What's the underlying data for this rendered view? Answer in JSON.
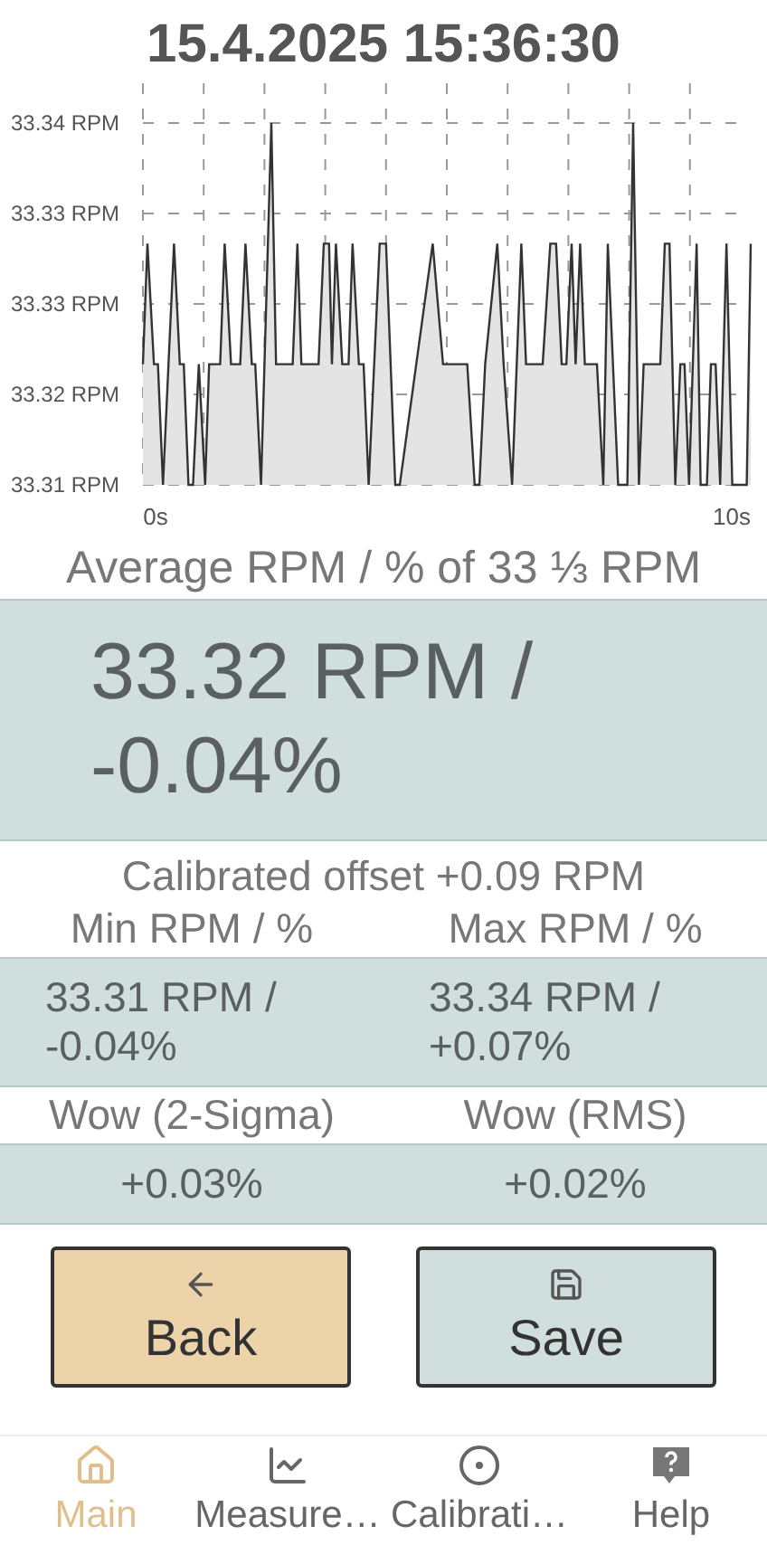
{
  "title": "15.4.2025 15:36:30",
  "chart": {
    "chart_data": {
      "type": "area",
      "grid": true,
      "xlim": [
        -0.22,
        10.33
      ],
      "ylim": [
        33.31,
        33.34
      ],
      "xticks": [
        {
          "value": 0,
          "label": "0s"
        },
        {
          "value": 10,
          "label": "10s"
        }
      ],
      "yticks": [
        {
          "value": 33.31,
          "label": "33.31 RPM"
        },
        {
          "value": 33.3175,
          "label": "33.32 RPM"
        },
        {
          "value": 33.325,
          "label": "33.33 RPM"
        },
        {
          "value": 33.3325,
          "label": "33.33 RPM"
        },
        {
          "value": 33.34,
          "label": "33.34 RPM"
        }
      ],
      "x": [
        -0.22,
        -0.14,
        -0.03,
        0.04,
        0.13,
        0.32,
        0.42,
        0.49,
        0.57,
        0.65,
        0.75,
        0.86,
        0.93,
        1.12,
        1.2,
        1.31,
        1.47,
        1.56,
        1.67,
        1.73,
        1.83,
        2.01,
        2.09,
        2.38,
        2.46,
        2.53,
        2.83,
        2.92,
        3.01,
        3.06,
        3.13,
        3.24,
        3.35,
        3.42,
        3.53,
        3.61,
        3.7,
        3.89,
        4,
        4.16,
        4.24,
        4.81,
        4.99,
        5.41,
        5.54,
        5.62,
        5.72,
        5.93,
        6.04,
        6.19,
        6.35,
        6.43,
        6.72,
        6.85,
        6.95,
        7.05,
        7.13,
        7.22,
        7.29,
        7.37,
        7.45,
        7.66,
        7.77,
        7.85,
        8.03,
        8.19,
        8.29,
        8.39,
        8.47,
        8.76,
        8.84,
        8.92,
        9.02,
        9.11,
        9.18,
        9.26,
        9.39,
        9.46,
        9.57,
        9.64,
        9.72,
        9.8,
        9.91,
        10.01,
        10.26,
        10.33
      ],
      "series": [
        {
          "color": "#e4e4e4",
          "values": [
            33.32,
            33.33,
            33.32,
            33.32,
            33.31,
            33.33,
            33.32,
            33.32,
            33.31,
            33.31,
            33.32,
            33.31,
            33.32,
            33.32,
            33.33,
            33.32,
            33.32,
            33.33,
            33.32,
            33.32,
            33.31,
            33.34,
            33.32,
            33.32,
            33.33,
            33.32,
            33.32,
            33.33,
            33.33,
            33.32,
            33.33,
            33.32,
            33.32,
            33.33,
            33.32,
            33.32,
            33.31,
            33.33,
            33.33,
            33.31,
            33.31,
            33.33,
            33.32,
            33.32,
            33.31,
            33.31,
            33.32,
            33.33,
            33.32,
            33.31,
            33.33,
            33.32,
            33.32,
            33.33,
            33.33,
            33.32,
            33.32,
            33.33,
            33.32,
            33.33,
            33.32,
            33.32,
            33.31,
            33.33,
            33.31,
            33.31,
            33.34,
            33.31,
            33.32,
            33.32,
            33.33,
            33.33,
            33.31,
            33.32,
            33.32,
            33.31,
            33.33,
            33.31,
            33.31,
            33.32,
            33.32,
            33.31,
            33.33,
            33.31,
            33.31,
            33.33
          ]
        }
      ]
    }
  },
  "average": {
    "label": "Average RPM / % of 33 ⅓ RPM",
    "value": "33.32 RPM / -0.04%"
  },
  "calibrated_offset": "Calibrated offset  +0.09 RPM",
  "stats": [
    {
      "label": "Min RPM / %",
      "value": "33.31 RPM / -0.04%"
    },
    {
      "label": "Max RPM / %",
      "value": "33.34 RPM / +0.07%"
    }
  ],
  "wow": [
    {
      "label": "Wow (2-Sigma)",
      "value": "+0.03%"
    },
    {
      "label": "Wow (RMS)",
      "value": "+0.02%"
    }
  ],
  "buttons": [
    {
      "kind": "back",
      "label": "Back"
    },
    {
      "kind": "save",
      "label": "Save"
    }
  ],
  "nav": [
    {
      "kind": "home",
      "label": "Main",
      "selected": true
    },
    {
      "kind": "chart",
      "label": "Measure…",
      "selected": false
    },
    {
      "kind": "target",
      "label": "Calibrati…",
      "selected": false
    },
    {
      "kind": "help",
      "label": "Help",
      "selected": false
    }
  ]
}
